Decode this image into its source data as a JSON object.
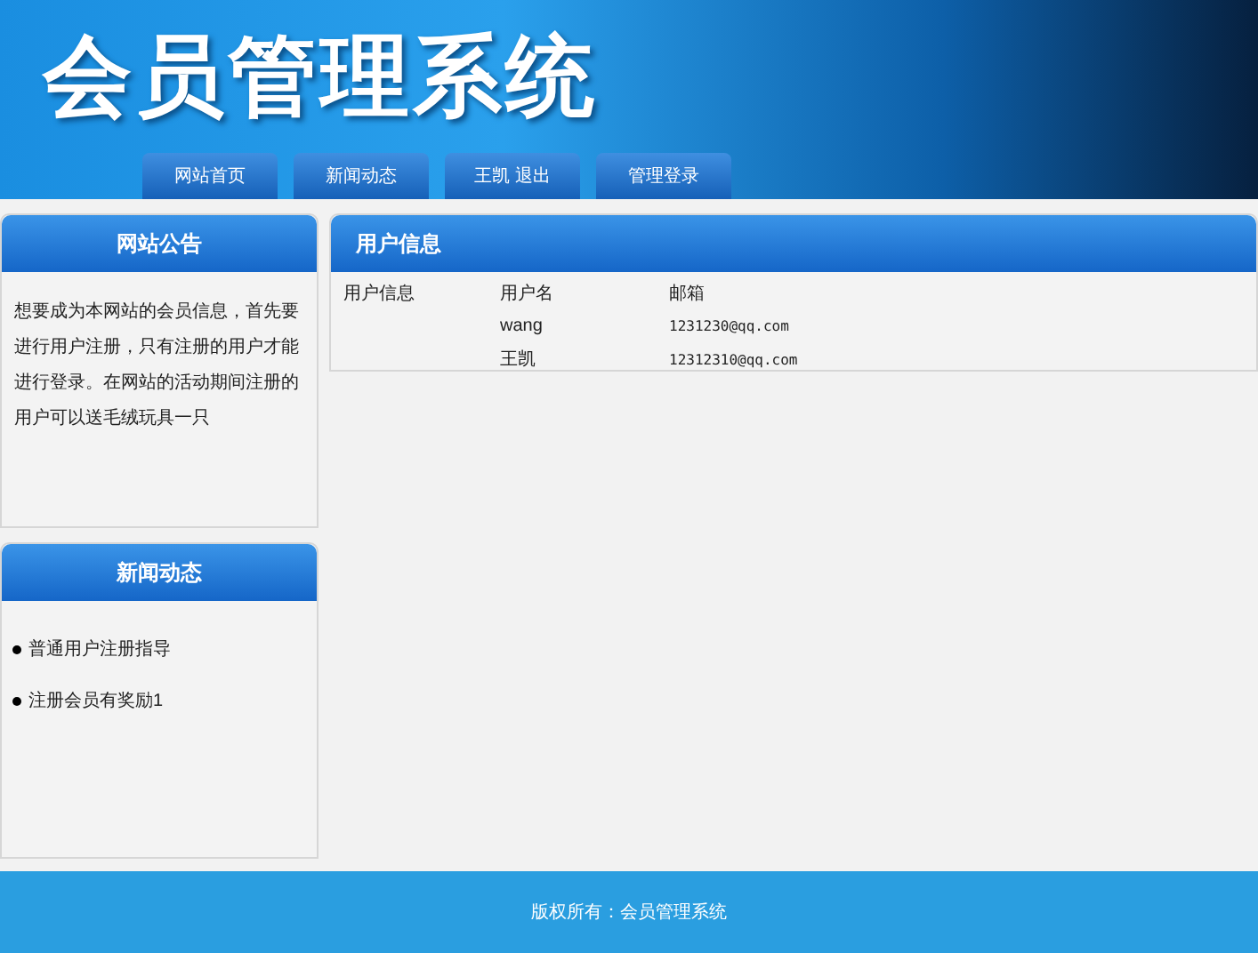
{
  "header": {
    "title": "会员管理系统"
  },
  "nav": [
    {
      "label": "网站首页"
    },
    {
      "label": "新闻动态"
    },
    {
      "label": "王凯 退出"
    },
    {
      "label": "管理登录"
    }
  ],
  "notice": {
    "title": "网站公告",
    "text": "想要成为本网站的会员信息，首先要进行用户注册，只有注册的用户才能进行登录。在网站的活动期间注册的用户可以送毛绒玩具一只"
  },
  "news": {
    "title": "新闻动态",
    "items": [
      "普通用户注册指导",
      "注册会员有奖励1"
    ]
  },
  "user_info": {
    "title": "用户信息",
    "columns": [
      "用户信息",
      "用户名",
      "邮箱"
    ],
    "rows": [
      {
        "username": "wang",
        "email": "1231230@qq.com"
      },
      {
        "username": "王凯",
        "email": "12312310@qq.com"
      }
    ]
  },
  "footer": {
    "text": "版权所有：会员管理系统"
  }
}
